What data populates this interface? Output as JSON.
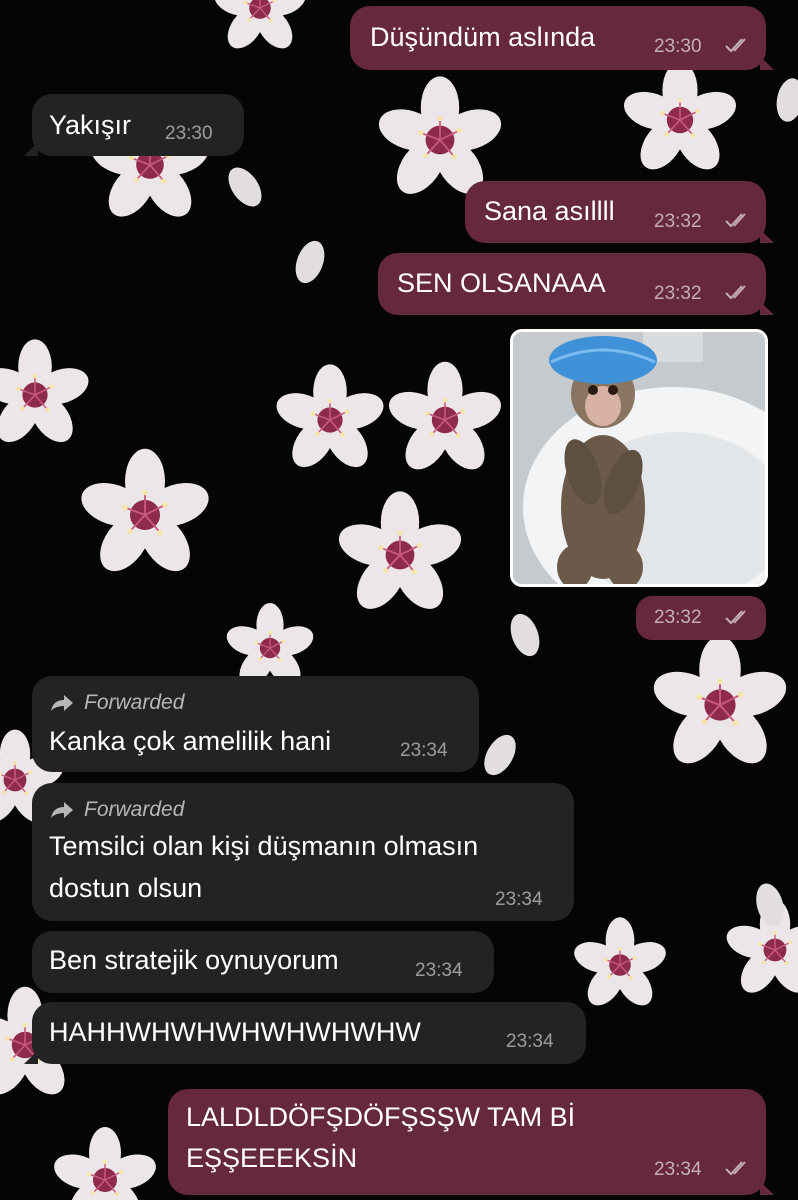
{
  "theme": {
    "outgoing_bubble": "#65283f",
    "incoming_bubble": "#232323",
    "background": "#050505"
  },
  "wallpaper": {
    "icon": "cherry-blossom-flowers"
  },
  "messages": [
    {
      "text": "Düşündüm aslında",
      "time": "23:30",
      "status_icon": "double-check-icon"
    },
    {
      "text": "Yakışır",
      "time": "23:30"
    },
    {
      "text": "Sana asıllll",
      "time": "23:32",
      "status_icon": "double-check-icon"
    },
    {
      "text": "SEN OLSANAAA",
      "time": "23:32",
      "status_icon": "double-check-icon"
    },
    {
      "media": "monkey-in-shower-cap-photo",
      "time": "23:32",
      "status_icon": "double-check-icon"
    },
    {
      "forwarded": "Forwarded",
      "text": "Kanka çok amelilik hani",
      "time": "23:34"
    },
    {
      "forwarded": "Forwarded",
      "text_line1": "Temsilci olan kişi düşmanın olmasın",
      "text_line2": "dostun olsun",
      "time": "23:34"
    },
    {
      "text": "Ben stratejik oynuyorum",
      "time": "23:34"
    },
    {
      "text": "HAHHWHWHWHWHWHWHW",
      "time": "23:34"
    },
    {
      "text_line1": "LALDLDÖFŞDÖFŞSŞW TAM Bİ",
      "text_line2": "EŞŞEEEKSİN",
      "time": "23:34",
      "status_icon": "double-check-icon"
    }
  ]
}
